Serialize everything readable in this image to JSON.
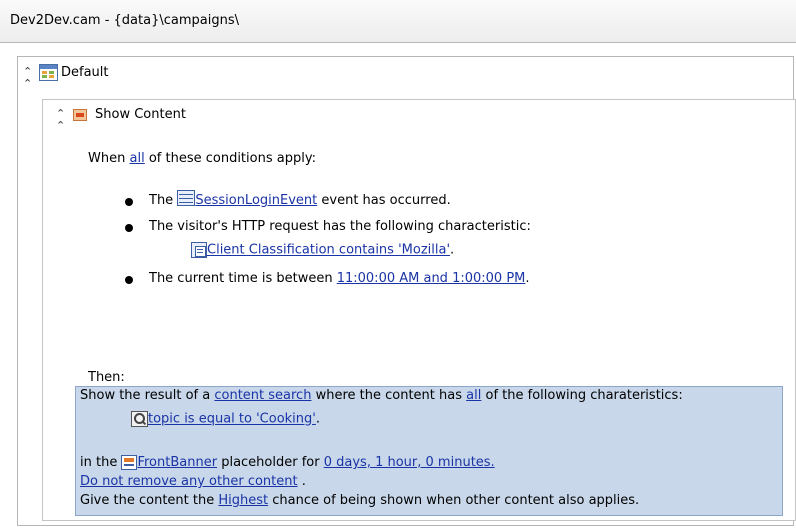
{
  "window": {
    "title": "Dev2Dev.cam - {data}\\campaigns\\"
  },
  "scenario": {
    "label": "Default"
  },
  "action": {
    "label": "Show Content"
  },
  "conditions": {
    "intro_prefix": "When",
    "intro_link": "all",
    "intro_suffix": "of these conditions apply:",
    "event": {
      "prefix": "The",
      "link": "SessionLoginEvent",
      "suffix": "event has occurred."
    },
    "http": {
      "text": "The visitor's HTTP request has the following characteristic:",
      "link": "Client Classification contains 'Mozilla'",
      "suffix": "."
    },
    "time": {
      "prefix": "The current time is between",
      "link": "11:00:00 AM and 1:00:00 PM",
      "suffix": "."
    }
  },
  "then": {
    "label": "Then:",
    "line1_prefix": "Show the result of a",
    "line1_link1": "content search",
    "line1_mid": "where the content has",
    "line1_link2": "all",
    "line1_suffix": "of the following charateristics:",
    "topic_link": "topic is equal to 'Cooking'",
    "topic_suffix": ".",
    "line3_prefix": "in the",
    "placeholder_link": "FrontBanner",
    "line3_mid": "placeholder for",
    "duration_link": "0 days, 1 hour, 0 minutes.",
    "remove_link": "Do not remove any other content",
    "remove_suffix": ".",
    "line5_prefix": "Give the content the",
    "priority_link": "Highest",
    "line5_suffix": "chance of being shown when other content also applies."
  },
  "icons": {
    "collapse": "double-chevron-up-icon",
    "scenario": "scenario-table-icon",
    "action": "show-content-icon",
    "event": "event-list-icon",
    "request": "request-property-icon",
    "search": "content-search-icon",
    "placeholder": "placeholder-icon"
  }
}
